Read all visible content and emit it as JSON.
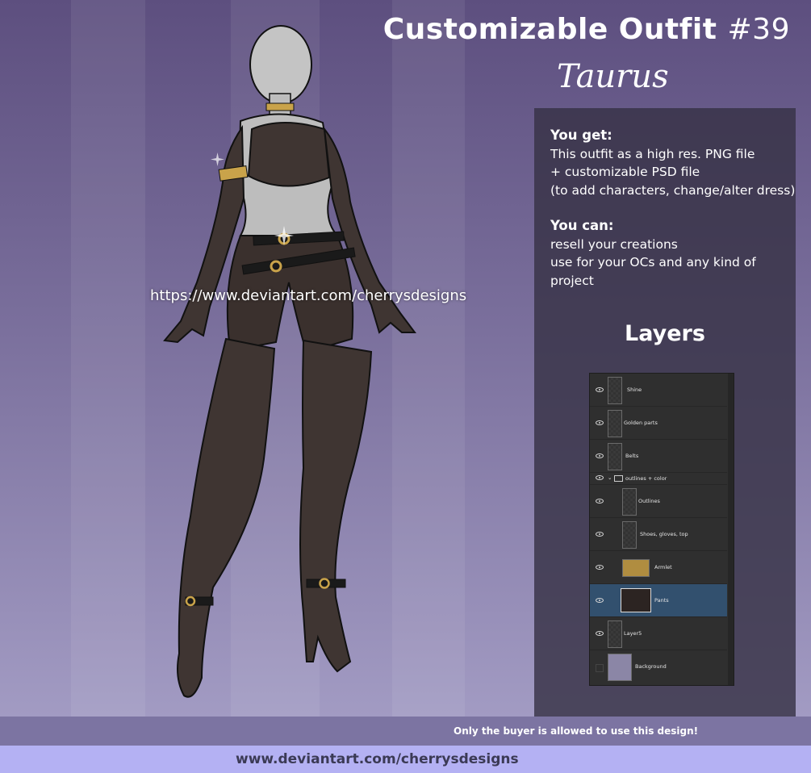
{
  "header": {
    "title": "Customizable Outfit",
    "number": "#39",
    "subtitle": "Taurus"
  },
  "info": {
    "you_get_heading": "You get:",
    "you_get_lines": [
      "This outfit as a high res. PNG file",
      "+ customizable PSD file",
      "(to add characters, change/alter dress)"
    ],
    "you_can_heading": "You can:",
    "you_can_lines": [
      "resell your creations",
      "use for your OCs and any kind of project"
    ]
  },
  "layers": {
    "title": "Layers",
    "items": [
      {
        "name": "Shine"
      },
      {
        "name": "Golden parts"
      },
      {
        "name": "Belts"
      },
      {
        "name": "outlines + color"
      },
      {
        "name": "Outlines"
      },
      {
        "name": "Shoes, gloves, top"
      },
      {
        "name": "Armlet"
      },
      {
        "name": "Pants"
      },
      {
        "name": "Layer5"
      },
      {
        "name": "Background"
      }
    ],
    "selected": "Pants"
  },
  "watermark_url": "https://www.deviantart.com/cherrysdesigns",
  "notice": "Only the buyer is allowed to use this design!",
  "footer_url": "www.deviantart.com/cherrysdesigns",
  "colors": {
    "background_top": "#5d4f7f",
    "background_bottom": "#a29bc3",
    "panel": "#373246",
    "selected_layer": "#32506e",
    "footer": "#b4b1f3",
    "notice_bar": "#7c74a2"
  }
}
